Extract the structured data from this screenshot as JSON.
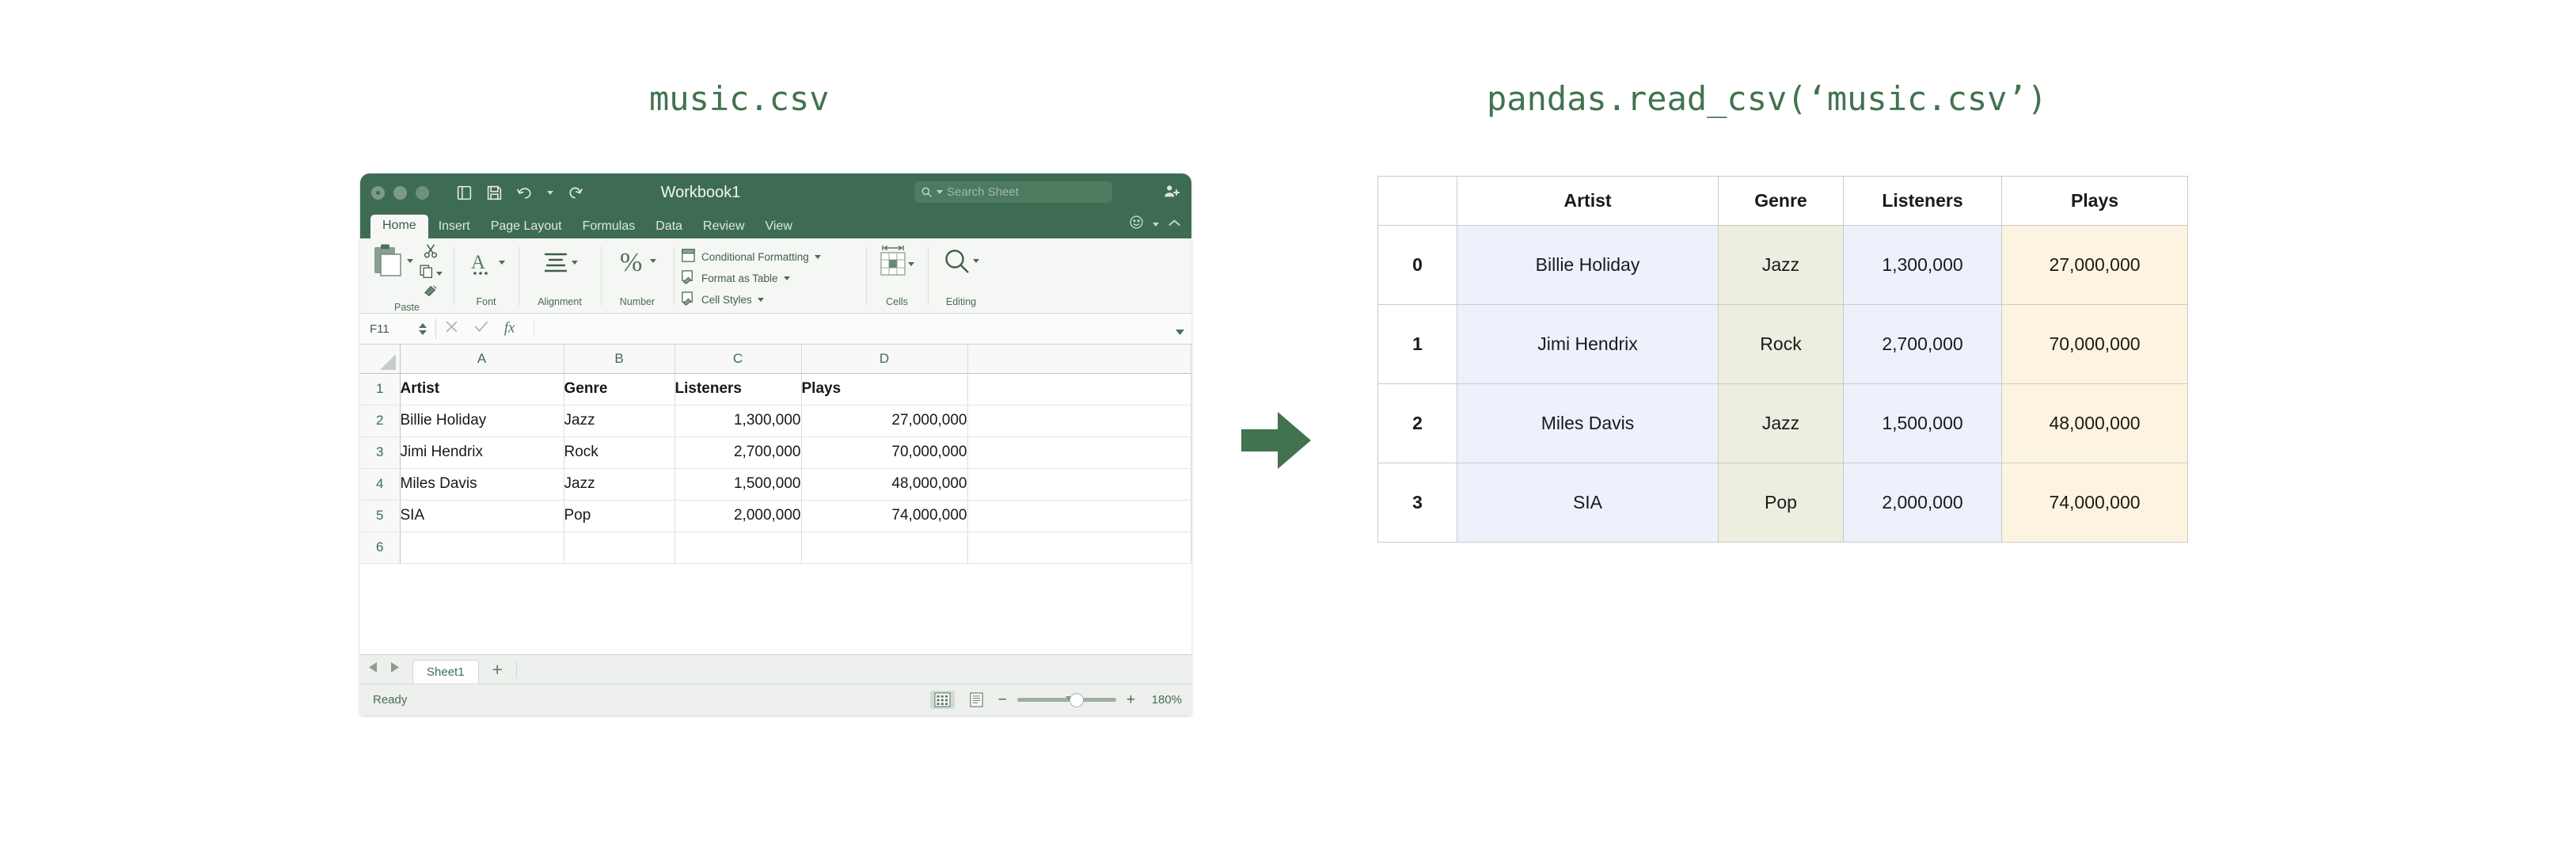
{
  "titles": {
    "left": "music.csv",
    "right": "pandas.read_csv(‘music.csv’)"
  },
  "arrow": {
    "name": "right-arrow",
    "color": "#41734F"
  },
  "excel": {
    "document_title": "Workbook1",
    "search_placeholder": "Search Sheet",
    "tabs": [
      {
        "label": "Home",
        "active": true
      },
      {
        "label": "Insert",
        "active": false
      },
      {
        "label": "Page Layout",
        "active": false
      },
      {
        "label": "Formulas",
        "active": false
      },
      {
        "label": "Data",
        "active": false
      },
      {
        "label": "Review",
        "active": false
      },
      {
        "label": "View",
        "active": false
      }
    ],
    "ribbon_groups": [
      {
        "label": "Paste"
      },
      {
        "label": "Font"
      },
      {
        "label": "Alignment"
      },
      {
        "label": "Number"
      },
      {
        "label": "Cells"
      },
      {
        "label": "Editing"
      }
    ],
    "ribbon_styles": [
      "Conditional Formatting",
      "Format as Table",
      "Cell Styles"
    ],
    "formula_bar": {
      "name_box": "F11",
      "formula_value": ""
    },
    "grid": {
      "column_headers": [
        "A",
        "B",
        "C",
        "D",
        ""
      ],
      "row_numbers": [
        "1",
        "2",
        "3",
        "4",
        "5",
        "6"
      ],
      "rows": [
        {
          "num": "1",
          "cells": [
            "Artist",
            "Genre",
            "Listeners",
            "Plays",
            ""
          ],
          "header": true
        },
        {
          "num": "2",
          "cells": [
            "Billie Holiday",
            "Jazz",
            "1,300,000",
            "27,000,000",
            ""
          ],
          "header": false
        },
        {
          "num": "3",
          "cells": [
            "Jimi Hendrix",
            "Rock",
            "2,700,000",
            "70,000,000",
            ""
          ],
          "header": false
        },
        {
          "num": "4",
          "cells": [
            "Miles Davis",
            "Jazz",
            "1,500,000",
            "48,000,000",
            ""
          ],
          "header": false
        },
        {
          "num": "5",
          "cells": [
            "SIA",
            "Pop",
            "2,000,000",
            "74,000,000",
            ""
          ],
          "header": false
        },
        {
          "num": "6",
          "cells": [
            "",
            "",
            "",
            "",
            ""
          ],
          "header": false
        }
      ]
    },
    "sheet_tabs": {
      "tabs": [
        "Sheet1"
      ],
      "add_label": "+"
    },
    "status": {
      "ready": "Ready",
      "zoom": "180%"
    }
  },
  "dataframe": {
    "columns": [
      "",
      "Artist",
      "Genre",
      "Listeners",
      "Plays"
    ],
    "rows": [
      {
        "index": "0",
        "Artist": "Billie Holiday",
        "Genre": "Jazz",
        "Listeners": "1,300,000",
        "Plays": "27,000,000"
      },
      {
        "index": "1",
        "Artist": "Jimi Hendrix",
        "Genre": "Rock",
        "Listeners": "2,700,000",
        "Plays": "70,000,000"
      },
      {
        "index": "2",
        "Artist": "Miles Davis",
        "Genre": "Jazz",
        "Listeners": "1,500,000",
        "Plays": "48,000,000"
      },
      {
        "index": "3",
        "Artist": "SIA",
        "Genre": "Pop",
        "Listeners": "2,000,000",
        "Plays": "74,000,000"
      }
    ],
    "colors": {
      "artist_bg": "#EDF1FB",
      "genre_bg": "#EDEEE0",
      "listeners_bg": "#EDF1FB",
      "plays_bg": "#FCF4E0"
    }
  }
}
